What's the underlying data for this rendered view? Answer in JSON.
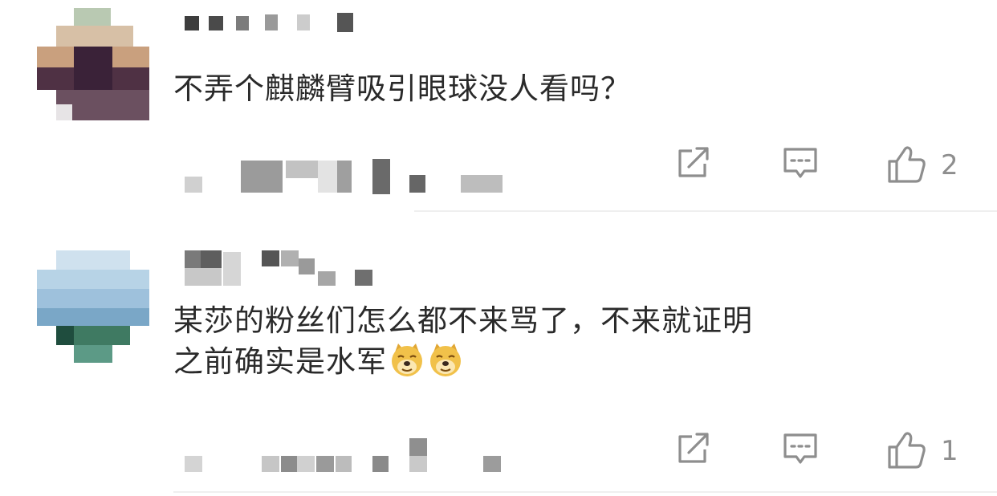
{
  "comments": [
    {
      "text_lines": [
        "不弄个麒麟臂吸引眼球没人看吗？"
      ],
      "like_count": "2",
      "username_censored": true,
      "avatar_censored": true
    },
    {
      "text_lines": [
        "某莎的粉丝们怎么都不来骂了，不来就证明",
        "之前确实是水军"
      ],
      "emojis": [
        "doge-emoji",
        "doge-emoji"
      ],
      "like_count": "1",
      "username_censored": true,
      "avatar_censored": true
    }
  ],
  "icons": {
    "share": "share-icon",
    "reply": "comment-icon",
    "like": "thumbs-up-icon"
  },
  "colors": {
    "text": "#2a2a2a",
    "icon": "#8e8e8e",
    "divider": "#efefef"
  }
}
